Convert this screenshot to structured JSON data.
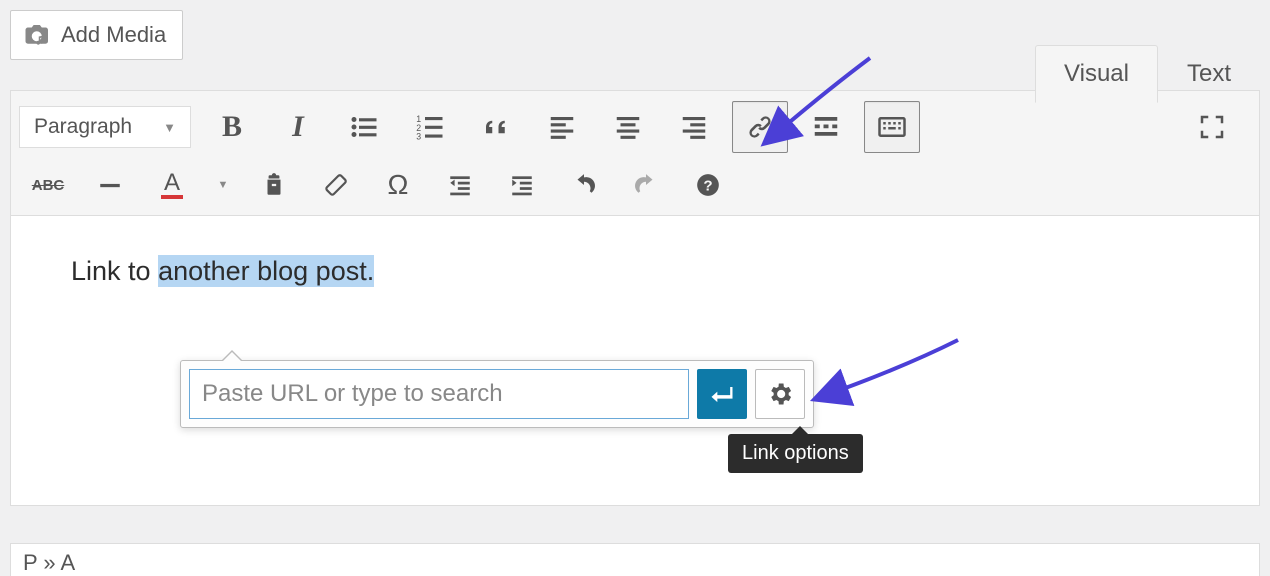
{
  "add_media_label": "Add Media",
  "tabs": {
    "visual": "Visual",
    "text": "Text"
  },
  "format_dropdown": "Paragraph",
  "content": {
    "before": "Link to ",
    "highlighted": "another blog post.",
    "after": ""
  },
  "link_popup": {
    "placeholder": "Paste URL or type to search",
    "tooltip": "Link options"
  },
  "status_path": "P » A",
  "toolbar": {
    "bold": "B",
    "italic": "I",
    "textcolor_letter": "A",
    "strike_label": "ABC"
  }
}
